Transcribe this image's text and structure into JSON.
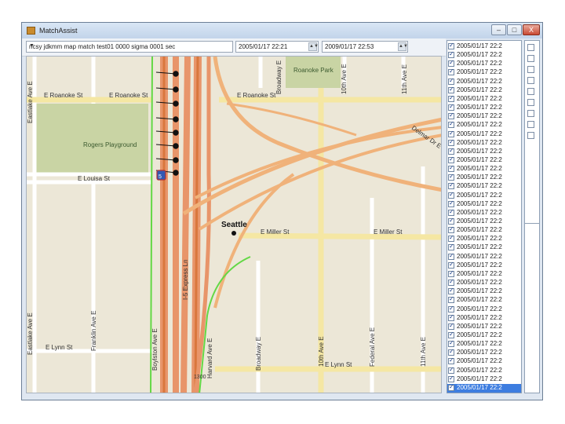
{
  "window": {
    "title": "MatchAssist",
    "minimize": "–",
    "maximize": "□",
    "close": "X"
  },
  "toolbar": {
    "query_value": "ncsy jdkmm map match test01 0000 sigma 0001 sec",
    "start_datetime": "2005/01/17 22:21",
    "end_datetime": "2009/01/17 22:53"
  },
  "map": {
    "streets": {
      "eastlake_ave_top": "Eastlake Ave E",
      "eastlake_ave_bottom": "Eastlake Ave E",
      "roanoke_w": "E Roanoke St",
      "roanoke_mid": "E Roanoke St",
      "roanoke_e": "E Roanoke St",
      "broadway_top": "Broadway E",
      "tenth_top": "10th Ave E",
      "eleventh_top": "11th Ave E",
      "louisa": "E Louisa St",
      "express": "I-5 Express Ln",
      "miller_w": "E Miller St",
      "miller_e": "E Miller St",
      "lynn_w": "E Lynn St",
      "lynn_e": "E Lynn St",
      "franklin": "Franklin Ave E",
      "boylston": "Boylston Ave E",
      "harvard": "Harvard Ave E",
      "broadway_bottom": "Broadway E",
      "tenth_bottom": "10th Ave E",
      "federal": "Federal Ave E",
      "eleventh_bottom": "11th Ave E",
      "delmar": "Delmar Dr E"
    },
    "places": {
      "park_roanoke": "Roanoke Park",
      "park_rogers": "Rogers Playground",
      "city": "Seattle",
      "highway_shield": "5"
    },
    "scale_label": "1300",
    "colors": {
      "freeway": "#e8956a",
      "freeway_core": "#d9773d",
      "arterial": "#f5c98a",
      "street": "#ffffff",
      "park": "#c9d4a4",
      "route": "#63d845",
      "background": "#ece7d7"
    }
  },
  "list": {
    "rows": [
      {
        "text": "2005/01/17 22:2",
        "checked": true
      },
      {
        "text": "2005/01/17 22:2",
        "checked": true
      },
      {
        "text": "2005/01/17 22:2",
        "checked": true
      },
      {
        "text": "2005/01/17 22:2",
        "checked": true
      },
      {
        "text": "2005/01/17 22:2",
        "checked": true
      },
      {
        "text": "2005/01/17 22:2",
        "checked": true
      },
      {
        "text": "2005/01/17 22:2",
        "checked": true
      },
      {
        "text": "2005/01/17 22:2",
        "checked": true
      },
      {
        "text": "2005/01/17 22:2",
        "checked": true
      },
      {
        "text": "2005/01/17 22:2",
        "checked": true
      },
      {
        "text": "2005/01/17 22:2",
        "checked": true
      },
      {
        "text": "2005/01/17 22:2",
        "checked": true
      },
      {
        "text": "2005/01/17 22:2",
        "checked": true
      },
      {
        "text": "2005/01/17 22:2",
        "checked": true
      },
      {
        "text": "2005/01/17 22:2",
        "checked": true
      },
      {
        "text": "2005/01/17 22:2",
        "checked": true
      },
      {
        "text": "2005/01/17 22:2",
        "checked": true
      },
      {
        "text": "2005/01/17 22:2",
        "checked": true
      },
      {
        "text": "2005/01/17 22:2",
        "checked": true
      },
      {
        "text": "2005/01/17 22:2",
        "checked": true
      },
      {
        "text": "2005/01/17 22:2",
        "checked": true
      },
      {
        "text": "2005/01/17 22:2",
        "checked": true
      },
      {
        "text": "2005/01/17 22:2",
        "checked": true
      },
      {
        "text": "2005/01/17 22:2",
        "checked": true
      },
      {
        "text": "2005/01/17 22:2",
        "checked": true
      },
      {
        "text": "2005/01/17 22:2",
        "checked": true
      },
      {
        "text": "2005/01/17 22:2",
        "checked": true
      },
      {
        "text": "2005/01/17 22:2",
        "checked": true
      },
      {
        "text": "2005/01/17 22:2",
        "checked": true
      },
      {
        "text": "2005/01/17 22:2",
        "checked": true
      },
      {
        "text": "2005/01/17 22:2",
        "checked": true
      },
      {
        "text": "2005/01/17 22:2",
        "checked": true
      },
      {
        "text": "2005/01/17 22:2",
        "checked": true
      },
      {
        "text": "2005/01/17 22:2",
        "checked": true
      },
      {
        "text": "2005/01/17 22:2",
        "checked": true
      },
      {
        "text": "2005/01/17 22:2",
        "checked": true
      },
      {
        "text": "2005/01/17 22:2",
        "checked": true
      },
      {
        "text": "2005/01/17 22:2",
        "checked": true
      },
      {
        "text": "2005/01/17 22:2",
        "checked": true
      },
      {
        "text": "2005/01/17 22:2",
        "checked": true
      }
    ],
    "selected_index": 39
  }
}
